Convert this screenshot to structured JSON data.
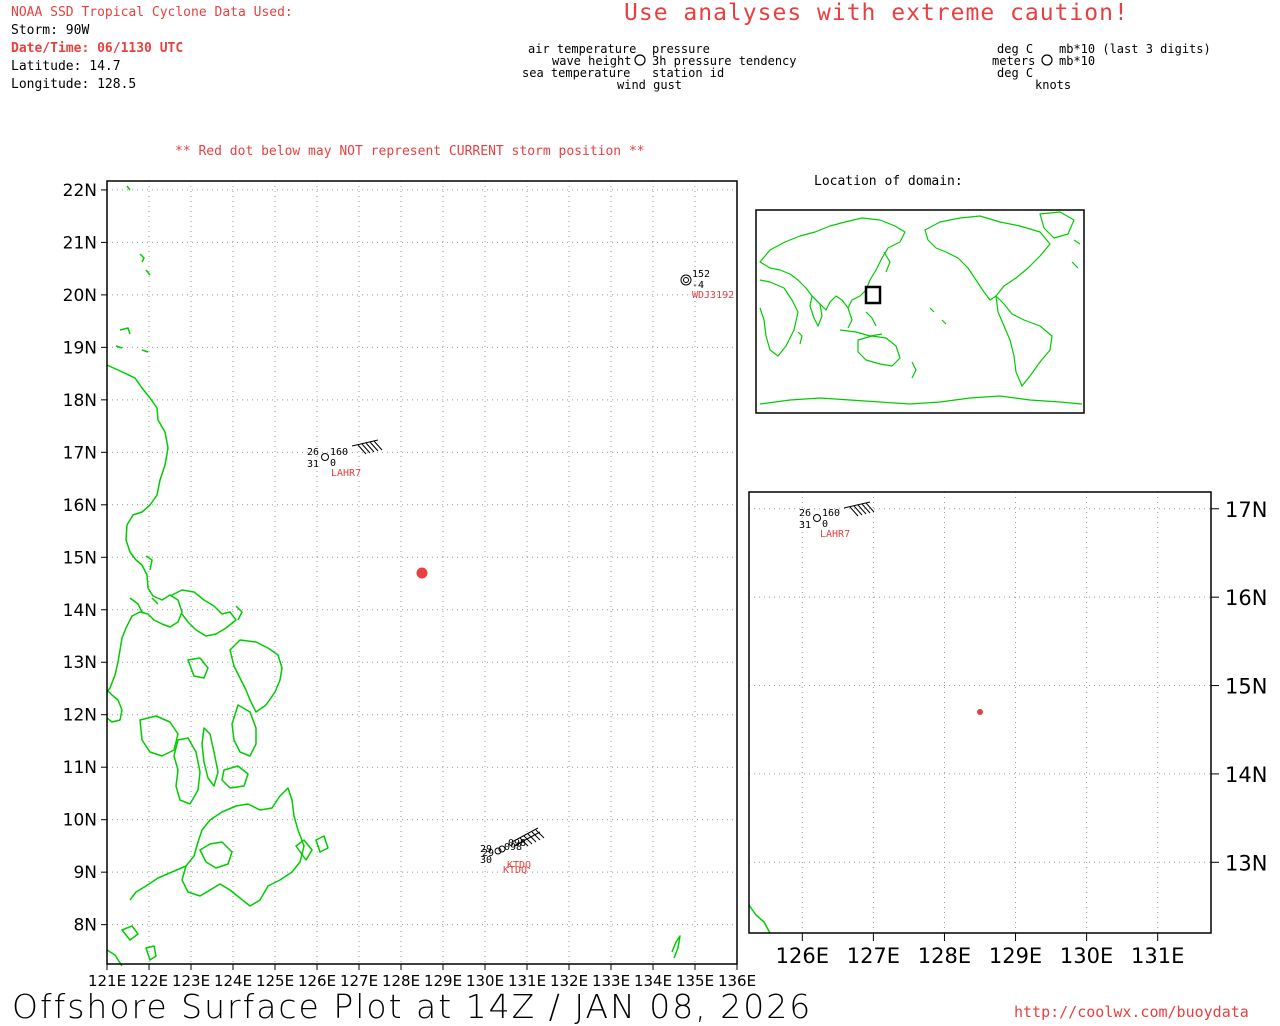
{
  "header": {
    "source": "NOAA SSD Tropical Cyclone Data Used:",
    "storm": "Storm: 90W",
    "datetime": "Date/Time: 06/1130 UTC",
    "latitude": "Latitude: 14.7",
    "longitude": "Longitude: 128.5",
    "caution": "Use analyses with extreme caution!"
  },
  "legend": {
    "left_labels": [
      "air temperature",
      "wave height",
      "sea temperature"
    ],
    "right_labels": [
      "pressure",
      "3h pressure tendency",
      "station id"
    ],
    "bottom_label": "wind gust",
    "units_left": [
      "deg C",
      "meters",
      "deg C"
    ],
    "units_right": [
      "mb*10 (last 3 digits)",
      "mb*10"
    ],
    "units_bottom": "knots"
  },
  "warning": "** Red dot below may NOT represent CURRENT storm position **",
  "inset_title": "Location of domain:",
  "main_map": {
    "lat_labels": [
      "22N",
      "21N",
      "20N",
      "19N",
      "18N",
      "17N",
      "16N",
      "15N",
      "14N",
      "13N",
      "12N",
      "11N",
      "10N",
      "9N",
      "8N"
    ],
    "lon_labels": [
      "121E",
      "122E",
      "123E",
      "124E",
      "125E",
      "126E",
      "127E",
      "128E",
      "129E",
      "130E",
      "131E",
      "132E",
      "133E",
      "134E",
      "135E",
      "136E"
    ]
  },
  "zoom_map": {
    "lat_labels": [
      "17N",
      "16N",
      "15N",
      "14N",
      "13N"
    ],
    "lon_labels": [
      "126E",
      "127E",
      "128E",
      "129E",
      "130E",
      "131E"
    ]
  },
  "stations": {
    "lahr7": {
      "id": "LAHR7",
      "air_temp": "26",
      "sea_temp": "31",
      "pressure": "160",
      "tendency": "0"
    },
    "wdj3192": {
      "id": "WDJ3192",
      "pressure": "152",
      "tendency": "-4"
    },
    "cluster": {
      "air_temp": "29",
      "sea_temp": "30",
      "pressure": "098",
      "ids": "KTDQ"
    }
  },
  "storm_position": {
    "lat": 14.7,
    "lon": 128.5
  },
  "footer": {
    "title": "Offshore Surface Plot at 14Z / JAN 08, 2026",
    "url": "http://coolwx.com/buoydata"
  },
  "colors": {
    "land": "#00cc00",
    "accent": "#e84040",
    "grid": "#999999"
  }
}
